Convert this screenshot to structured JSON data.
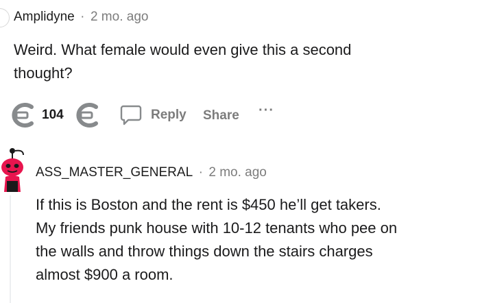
{
  "comment1": {
    "author": "Amplidyne",
    "separator": "·",
    "time": "2 mo. ago",
    "body_lines": [
      "Weird. What female would even give this a second",
      "thought?"
    ],
    "actions": {
      "score": "104",
      "reply": "Reply",
      "share": "Share",
      "more": "···"
    },
    "icons": {
      "upvote": "upvote-c-icon",
      "downvote": "downvote-c-icon",
      "reply": "speech-bubble-icon",
      "more": "ellipsis-icon"
    }
  },
  "comment2": {
    "author": "ASS_MASTER_GENERAL",
    "separator": "·",
    "time": "2 mo. ago",
    "avatar": "red-snoo-avatar",
    "body_lines": [
      "If this is Boston and the rent is $450 he’ll get takers.",
      "My friends punk house with 10-12 tenants who pee on",
      "the walls and throw things down the stairs charges",
      "almost $900 a room."
    ]
  },
  "colors": {
    "meta_gray": "#7c7c7c",
    "text": "#1a1a1b",
    "avatar_red": "#e8154e",
    "thread_line": "#edeff1"
  }
}
